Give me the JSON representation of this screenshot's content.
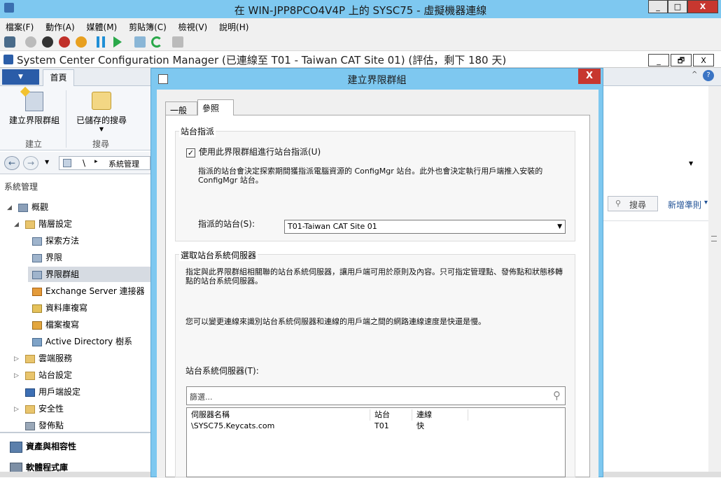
{
  "vm": {
    "title": "在 WIN-JPP8PCO4V4P 上的 SYSC75 - 虛擬機器連線",
    "menu": [
      "檔案(F)",
      "動作(A)",
      "媒體(M)",
      "剪貼簿(C)",
      "檢視(V)",
      "說明(H)"
    ],
    "window_buttons": [
      "_",
      "□",
      "X"
    ]
  },
  "sccm": {
    "title": "System Center Configuration Manager (已連線至 T01 - Taiwan CAT Site 01) (評估，剩下 180 天)",
    "window_buttons": [
      "_",
      "🗗",
      "X"
    ],
    "ribbon_tab": "首頁",
    "ribbon_buttons": [
      {
        "label": "建立界限群組",
        "group": "建立"
      },
      {
        "label": "已儲存的搜尋",
        "group": "搜尋"
      }
    ],
    "nav_path": [
      "\\",
      "▸",
      "系統管理"
    ],
    "pane_title": "系統管理",
    "tree": [
      {
        "label": "概觀",
        "level": 0
      },
      {
        "label": "階層設定",
        "level": 1
      },
      {
        "label": "探索方法",
        "level": 2
      },
      {
        "label": "界限",
        "level": 2
      },
      {
        "label": "界限群組",
        "level": 2,
        "selected": true
      },
      {
        "label": "Exchange Server 連接器",
        "level": 2
      },
      {
        "label": "資料庫複寫",
        "level": 2
      },
      {
        "label": "檔案複寫",
        "level": 2
      },
      {
        "label": "Active Directory 樹系",
        "level": 2
      },
      {
        "label": "雲端服務",
        "level": 1
      },
      {
        "label": "站台設定",
        "level": 1
      },
      {
        "label": "用戶端設定",
        "level": 1
      },
      {
        "label": "安全性",
        "level": 1
      },
      {
        "label": "發佈點",
        "level": 1
      }
    ],
    "workspaces": [
      "資產與相容性",
      "軟體程式庫"
    ],
    "search_label": "搜尋",
    "advanced_label": "新增準則"
  },
  "dialog": {
    "title": "建立界限群組",
    "close": "X",
    "tabs": [
      "一般",
      "參照"
    ],
    "site_assignment": {
      "group_title": "站台指派",
      "checkbox_label": "使用此界限群組進行站台指派(U)",
      "checked": true,
      "description": "指派的站台會決定探索期間獲指派電腦資源的 ConfigMgr 站台。此外也會決定執行用戶端推入安裝的 ConfigMgr 站台。",
      "assigned_label": "指派的站台(S):",
      "assigned_value": "T01-Taiwan CAT Site 01"
    },
    "site_servers": {
      "group_title": "選取站台系統伺服器",
      "description1": "指定與此界限群組相關聯的站台系統伺服器，讓用戶端可用於原則及內容。只可指定管理點、發佈點和狀態移轉點的站台系統伺服器。",
      "description2": "您可以變更連線來識別站台系統伺服器和連線的用戶端之間的網路連線速度是快還是慢。",
      "list_label": "站台系統伺服器(T):",
      "filter_placeholder": "篩選...",
      "columns": [
        "伺服器名稱",
        "站台",
        "連線"
      ],
      "rows": [
        {
          "server": "\\SYSC75.Keycats.com",
          "site": "T01",
          "connection": "快"
        }
      ]
    }
  }
}
